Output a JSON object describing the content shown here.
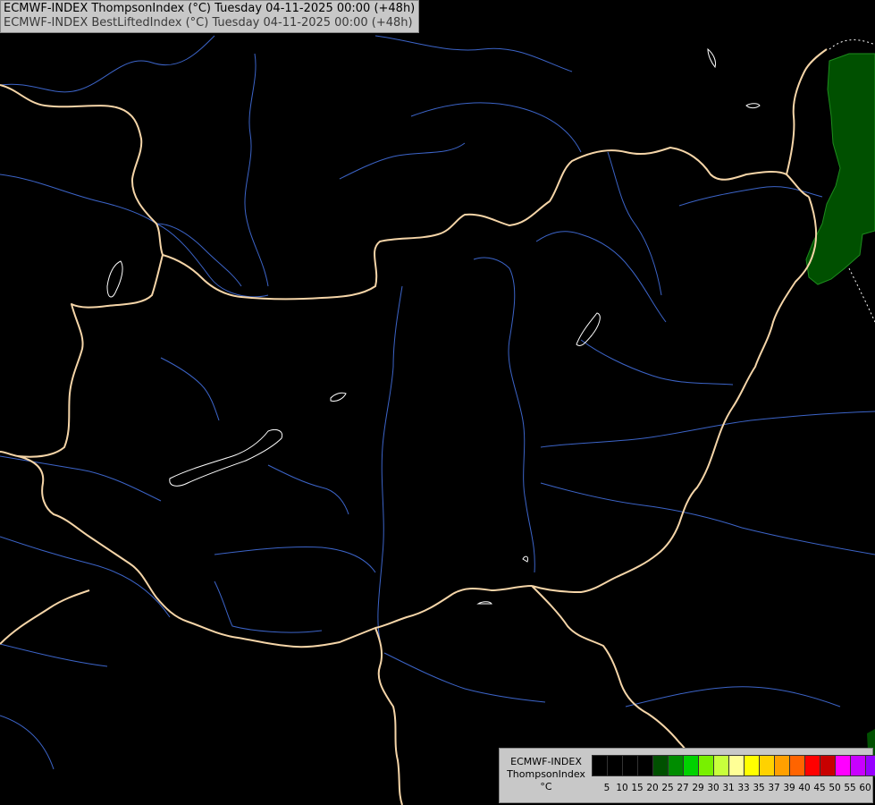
{
  "header": {
    "line1": "ECMWF-INDEX ThompsonIndex (°C) Tuesday 04-11-2025 00:00 (+48h)",
    "line2": "ECMWF-INDEX BestLiftedIndex (°C) Tuesday 04-11-2025 00:00 (+48h)"
  },
  "map": {
    "background_color": "#000000",
    "border_color": "#f5d5a8",
    "river_color": "#3c64c8",
    "lake_color": "#ffffff",
    "field_colors": [
      "#005000",
      "#1e8c1e"
    ]
  },
  "legend": {
    "label_line1": "ECMWF-INDEX",
    "label_line2": "ThompsonIndex",
    "label_line3": "°C",
    "swatch_colors": [
      "#000000",
      "#000000",
      "#000000",
      "#000000",
      "#005000",
      "#008c00",
      "#00d200",
      "#78f000",
      "#c8ff3c",
      "#ffff96",
      "#ffff00",
      "#ffd200",
      "#ffa000",
      "#ff6400",
      "#ff0000",
      "#c80000",
      "#ff00ff",
      "#c800ff",
      "#9600ff",
      "#6400ff",
      "#0000ff"
    ],
    "ticks": [
      "5",
      "10",
      "15",
      "20",
      "25",
      "27",
      "29",
      "30",
      "31",
      "33",
      "35",
      "37",
      "39",
      "40",
      "45",
      "50",
      "55",
      "60"
    ]
  }
}
